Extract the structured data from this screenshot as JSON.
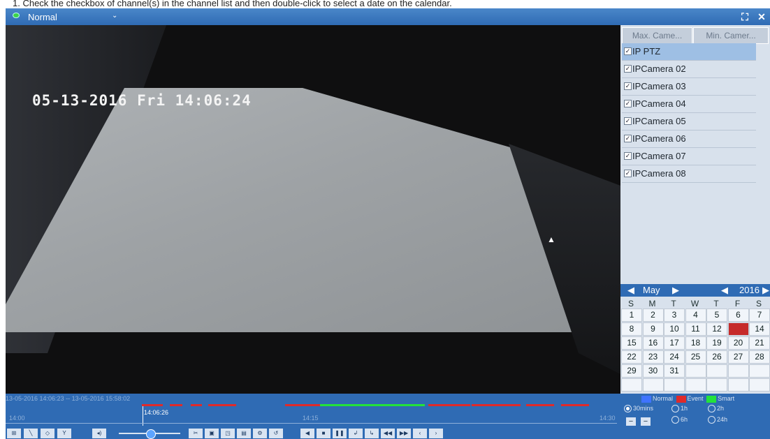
{
  "instruction": "1.  Check the checkbox of channel(s) in the channel list and then double-click to select a date on the calendar.",
  "topbar": {
    "mode_label": "Normal",
    "fullscreen_icon": "expand-icon",
    "close_icon": "close-icon"
  },
  "video": {
    "timestamp": "05-13-2016 Fri 14:06:24"
  },
  "channels": {
    "max_button": "Max. Came...",
    "min_button": "Min. Camer...",
    "items": [
      {
        "label": "IP PTZ",
        "checked": true,
        "selected": true
      },
      {
        "label": "IPCamera 02",
        "checked": true,
        "selected": false
      },
      {
        "label": "IPCamera 03",
        "checked": true,
        "selected": false
      },
      {
        "label": "IPCamera 04",
        "checked": true,
        "selected": false
      },
      {
        "label": "IPCamera 05",
        "checked": true,
        "selected": false
      },
      {
        "label": "IPCamera 06",
        "checked": true,
        "selected": false
      },
      {
        "label": "IPCamera 07",
        "checked": true,
        "selected": false
      },
      {
        "label": "IPCamera 08",
        "checked": true,
        "selected": false
      }
    ]
  },
  "calendar": {
    "month": "May",
    "year": "2016",
    "weekdays": [
      "S",
      "M",
      "T",
      "W",
      "T",
      "F",
      "S"
    ],
    "days": [
      [
        "1",
        "2",
        "3",
        "4",
        "5",
        "6",
        "7"
      ],
      [
        "8",
        "9",
        "10",
        "11",
        "12",
        "13",
        "14"
      ],
      [
        "15",
        "16",
        "17",
        "18",
        "19",
        "20",
        "21"
      ],
      [
        "22",
        "23",
        "24",
        "25",
        "26",
        "27",
        "28"
      ],
      [
        "29",
        "30",
        "31",
        "",
        "",
        "",
        ""
      ],
      [
        "",
        "",
        "",
        "",
        "",
        "",
        ""
      ]
    ],
    "highlighted_day": "13",
    "highlight_color": "#c62b2b"
  },
  "timeline": {
    "range_text": "13-05-2016 14:06:23 -- 13-05-2016 15:58:02",
    "ticks": [
      "14:00",
      "14:15",
      "14:30"
    ],
    "current_time": "14:06:26",
    "legend": [
      {
        "label": "Normal",
        "color": "#3f74ff"
      },
      {
        "label": "Event",
        "color": "#e02a2a"
      },
      {
        "label": "Smart",
        "color": "#23e23a"
      }
    ],
    "scale_options": [
      {
        "label": "30mins",
        "selected": true
      },
      {
        "label": "1h",
        "selected": false
      },
      {
        "label": "2h",
        "selected": false
      },
      {
        "label": "6h",
        "selected": false
      },
      {
        "label": "24h",
        "selected": false
      }
    ]
  }
}
